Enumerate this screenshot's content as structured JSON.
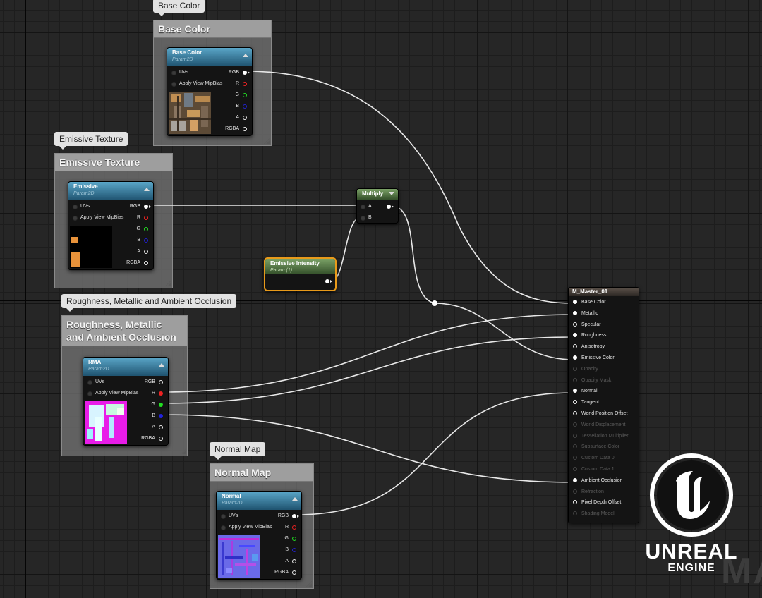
{
  "comments": [
    {
      "id": "base",
      "title": "Base Color",
      "bubble": "Base Color"
    },
    {
      "id": "emissive",
      "title": "Emissive Texture",
      "bubble": "Emissive Texture"
    },
    {
      "id": "rma",
      "title_line1": "Roughness, Metallic",
      "title_line2": "and Ambient Occlusion",
      "bubble": "Roughness, Metallic and Ambient Occlusion"
    },
    {
      "id": "normal",
      "title": "Normal Map",
      "bubble": "Normal Map"
    }
  ],
  "texture_nodes": {
    "base": {
      "title": "Base Color",
      "subtitle": "Param2D"
    },
    "emissive": {
      "title": "Emissive",
      "subtitle": "Param2D"
    },
    "rma": {
      "title": "RMA",
      "subtitle": "Param2D"
    },
    "normal": {
      "title": "Normal",
      "subtitle": "Param2D"
    }
  },
  "texture_pins": {
    "uvs": "UVs",
    "mip": "Apply View MipBias",
    "rgb": "RGB",
    "r": "R",
    "g": "G",
    "b": "B",
    "a": "A",
    "rgba": "RGBA"
  },
  "multiply": {
    "title": "Multiply",
    "pin_a": "A",
    "pin_b": "B"
  },
  "scalar": {
    "title": "Emissive Intensity",
    "subtitle": "Param (1)"
  },
  "master": {
    "title": "M_Master_01",
    "pins": [
      "Base Color",
      "Metallic",
      "Specular",
      "Roughness",
      "Anisotropy",
      "Emissive Color",
      "Opacity",
      "Opacity Mask",
      "Normal",
      "Tangent",
      "World Position Offset",
      "World Displacement",
      "Tessellation Multiplier",
      "Subsurface Color",
      "Custom Data 0",
      "Custom Data 1",
      "Ambient Occlusion",
      "Refraction",
      "Pixel Depth Offset",
      "Shading Model"
    ]
  },
  "logo": {
    "word1": "UNREAL",
    "word2": "ENGINE",
    "bg_text": "MA"
  },
  "colors": {
    "wire": "#e8e8e8",
    "texture_header": "#2a6a8c",
    "scalar_header": "#4f7a3c",
    "selected_outline": "#e89a1a"
  }
}
